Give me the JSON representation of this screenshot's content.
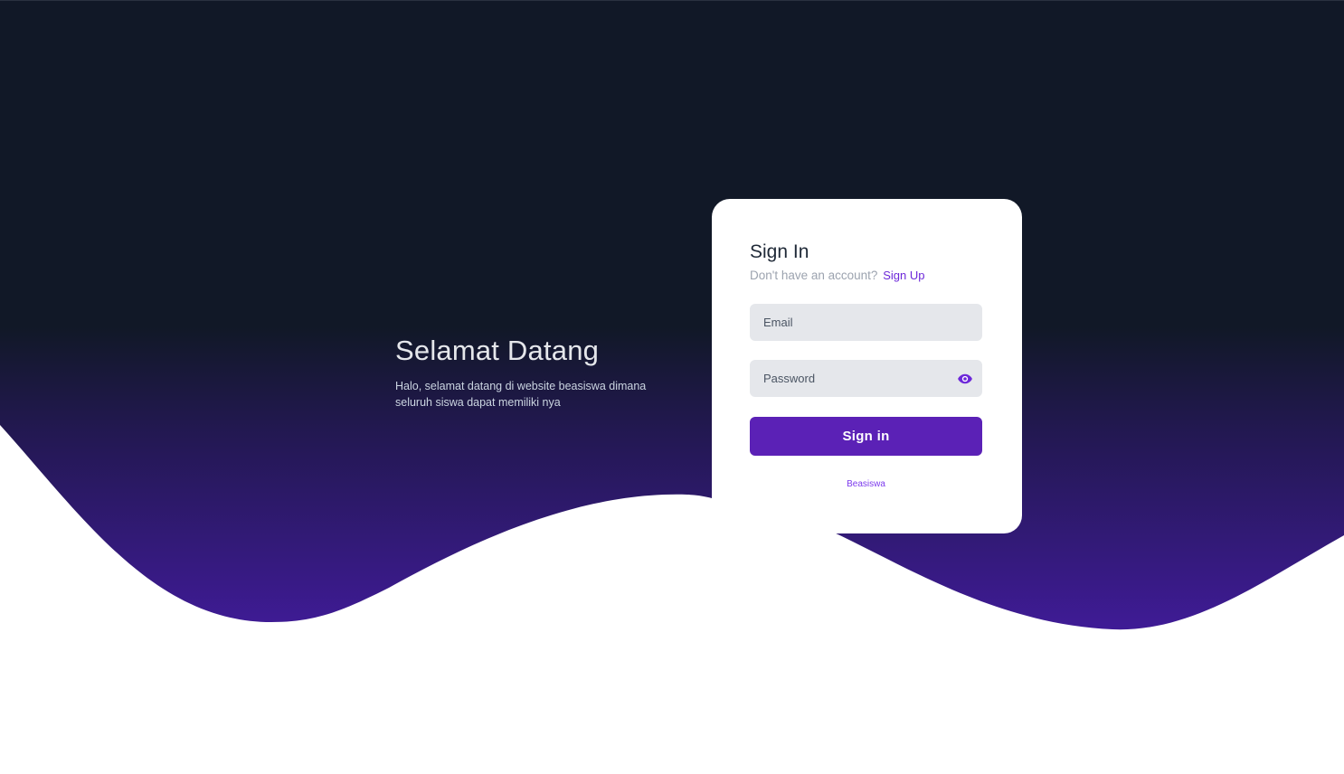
{
  "welcome": {
    "title": "Selamat Datang",
    "subtitle": "Halo, selamat datang di website beasiswa dimana seluruh siswa dapat memiliki nya"
  },
  "signin": {
    "title": "Sign In",
    "prompt": "Don't have an account?",
    "signup_link": "Sign Up",
    "email_placeholder": "Email",
    "password_placeholder": "Password",
    "submit_label": "Sign in",
    "footer_link": "Beasiswa",
    "password_toggle_icon": "eye-icon"
  },
  "colors": {
    "background_dark": "#111827",
    "wave_purple": "#3b1a8c",
    "accent": "#5b21b6",
    "link": "#6d28d9"
  }
}
